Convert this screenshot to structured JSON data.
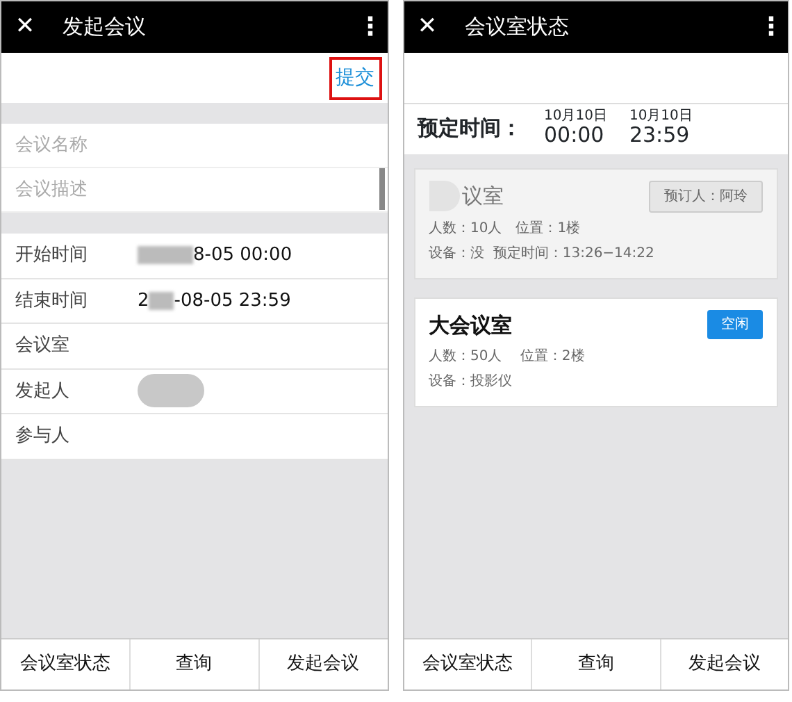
{
  "screens": [
    {
      "kind": "form",
      "title": "发起会议",
      "close": "✕",
      "more": "⋮",
      "submit": "提交",
      "submit_highlighted": true,
      "fields": [
        {
          "placeholder": "会议名称"
        },
        {
          "placeholder": "会议描述"
        }
      ],
      "rows": [
        {
          "label": "开始时间",
          "value": [
            {
              "kind": "blur"
            },
            {
              "kind": "text",
              "text": "8-05 00:00"
            }
          ]
        },
        {
          "label": "结束时间",
          "value": [
            {
              "kind": "text",
              "text": "2"
            },
            {
              "kind": "blur"
            },
            {
              "kind": "text",
              "text": "-08-05 23:59"
            }
          ]
        },
        {
          "label": "会议室",
          "value": []
        },
        {
          "label": "发起人",
          "value": [
            {
              "kind": "avatar"
            }
          ]
        },
        {
          "label": "参与人",
          "value": []
        }
      ],
      "nav": [
        {
          "label": "会议室状态"
        },
        {
          "label": "查询"
        },
        {
          "label": "发起会议"
        }
      ]
    },
    {
      "kind": "status",
      "title": "会议室状态",
      "close": "✕",
      "more": "⋮",
      "time_label": "预定时间：",
      "times": [
        {
          "date": "10月10日",
          "time": "00:00"
        },
        {
          "date": "10月10日",
          "time": "23:59"
        }
      ],
      "rooms": [
        {
          "name": "议室",
          "name_blurred": true,
          "busy": true,
          "tag": "预订人：阿玲",
          "info": [
            "人数：10人　位置：1楼",
            "设备：没  预定时间：13:26−14:22"
          ]
        },
        {
          "name": "大会议室",
          "name_blurred": false,
          "busy": false,
          "tag": "空闲",
          "info": [
            "人数：50人　 位置：2楼",
            "设备：投影仪"
          ]
        }
      ],
      "nav": [
        {
          "label": "会议室状态"
        },
        {
          "label": "查询"
        },
        {
          "label": "发起会议"
        }
      ]
    }
  ]
}
